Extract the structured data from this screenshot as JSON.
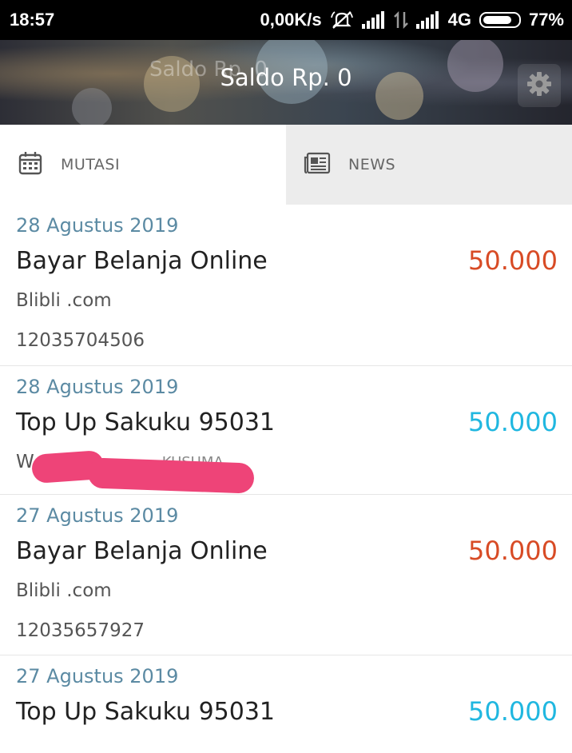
{
  "status_bar": {
    "time": "18:57",
    "speed": "0,00K/s",
    "network": "4G",
    "battery": "77%",
    "battery_level": 0.77,
    "icons": [
      "mute-notification-icon",
      "signal-icon",
      "data-arrows-icon",
      "signal-icon",
      "battery-icon"
    ]
  },
  "header": {
    "ghost_text": "Saldo Rp. 0",
    "saldo": "Saldo Rp. 0",
    "settings_icon": "gear-icon"
  },
  "tabs": [
    {
      "label": "MUTASI",
      "icon": "calendar-icon",
      "active": true
    },
    {
      "label": "NEWS",
      "icon": "newspaper-icon",
      "active": false
    }
  ],
  "transactions": [
    {
      "date": "28 Agustus 2019",
      "title": "Bayar Belanja Online",
      "amount": "50.000",
      "type": "debit",
      "merchant": "Blibli .com",
      "reference": "12035704506"
    },
    {
      "date": "28 Agustus 2019",
      "title": "Top Up Sakuku 95031",
      "amount": "50.000",
      "type": "credit",
      "visible_fragment": "W",
      "visible_fragment_tail": "KUSUMA"
    },
    {
      "date": "27 Agustus 2019",
      "title": "Bayar Belanja Online",
      "amount": "50.000",
      "type": "debit",
      "merchant": "Blibli .com",
      "reference": "12035657927"
    },
    {
      "date": "27 Agustus 2019",
      "title": "Top Up Sakuku 95031",
      "amount": "50.000",
      "type": "credit"
    }
  ],
  "colors": {
    "debit": "#d84b25",
    "credit": "#20b7e0",
    "date": "#5b8aa3",
    "redaction": "#ee4478"
  }
}
